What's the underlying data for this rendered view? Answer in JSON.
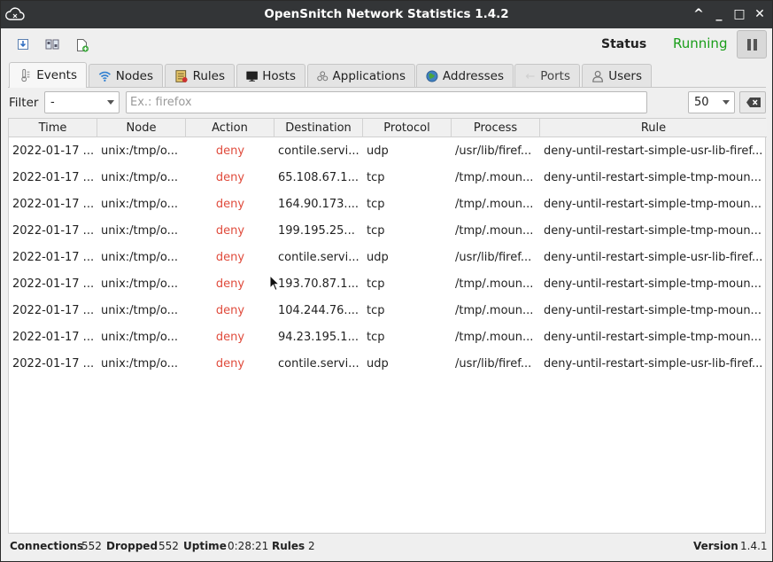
{
  "window": {
    "title": "OpenSnitch Network Statistics 1.4.2",
    "controls": [
      "^",
      "_",
      "□",
      "✕"
    ]
  },
  "toolbar": {
    "status_label": "Status",
    "status_value": "Running",
    "status_color": "#1a9e1a"
  },
  "tabs": [
    {
      "label": "Events",
      "icon": "events-icon",
      "active": true
    },
    {
      "label": "Nodes",
      "icon": "wifi-icon",
      "active": false
    },
    {
      "label": "Rules",
      "icon": "rules-icon",
      "active": false
    },
    {
      "label": "Hosts",
      "icon": "monitor-icon",
      "active": false
    },
    {
      "label": "Applications",
      "icon": "applications-icon",
      "active": false
    },
    {
      "label": "Addresses",
      "icon": "globe-icon",
      "active": false
    },
    {
      "label": "Ports",
      "icon": "arrow-left-icon",
      "active": false
    },
    {
      "label": "Users",
      "icon": "user-icon",
      "active": false
    }
  ],
  "filter": {
    "label": "Filter",
    "combo_value": "-",
    "search_placeholder": "Ex.: firefox",
    "search_value": "",
    "limit_value": "50"
  },
  "table": {
    "columns": [
      "Time",
      "Node",
      "Action",
      "Destination",
      "Protocol",
      "Process",
      "Rule"
    ],
    "rows": [
      [
        "2022-01-17 ...",
        "unix:/tmp/o...",
        "deny",
        "contile.servi...",
        "udp",
        "/usr/lib/firef...",
        "deny-until-restart-simple-usr-lib-firef..."
      ],
      [
        "2022-01-17 ...",
        "unix:/tmp/o...",
        "deny",
        "65.108.67.1...",
        "tcp",
        "/tmp/.moun...",
        "deny-until-restart-simple-tmp-moun..."
      ],
      [
        "2022-01-17 ...",
        "unix:/tmp/o...",
        "deny",
        "164.90.173....",
        "tcp",
        "/tmp/.moun...",
        "deny-until-restart-simple-tmp-moun..."
      ],
      [
        "2022-01-17 ...",
        "unix:/tmp/o...",
        "deny",
        "199.195.25...",
        "tcp",
        "/tmp/.moun...",
        "deny-until-restart-simple-tmp-moun..."
      ],
      [
        "2022-01-17 ...",
        "unix:/tmp/o...",
        "deny",
        "contile.servi...",
        "udp",
        "/usr/lib/firef...",
        "deny-until-restart-simple-usr-lib-firef..."
      ],
      [
        "2022-01-17 ...",
        "unix:/tmp/o...",
        "deny",
        "193.70.87.1...",
        "tcp",
        "/tmp/.moun...",
        "deny-until-restart-simple-tmp-moun..."
      ],
      [
        "2022-01-17 ...",
        "unix:/tmp/o...",
        "deny",
        "104.244.76....",
        "tcp",
        "/tmp/.moun...",
        "deny-until-restart-simple-tmp-moun..."
      ],
      [
        "2022-01-17 ...",
        "unix:/tmp/o...",
        "deny",
        "94.23.195.1...",
        "tcp",
        "/tmp/.moun...",
        "deny-until-restart-simple-tmp-moun..."
      ],
      [
        "2022-01-17 ...",
        "unix:/tmp/o...",
        "deny",
        "contile.servi...",
        "udp",
        "/usr/lib/firef...",
        "deny-until-restart-simple-usr-lib-firef..."
      ]
    ],
    "deny_color": "#e04b3c"
  },
  "statusbar": {
    "connections_label": "Connections",
    "connections_value": "552",
    "dropped_label": "Dropped",
    "dropped_value": "552",
    "uptime_label": "Uptime",
    "uptime_value": "0:28:21",
    "rules_label": "Rules",
    "rules_value": "2",
    "version_label": "Version",
    "version_value": "1.4.1"
  }
}
